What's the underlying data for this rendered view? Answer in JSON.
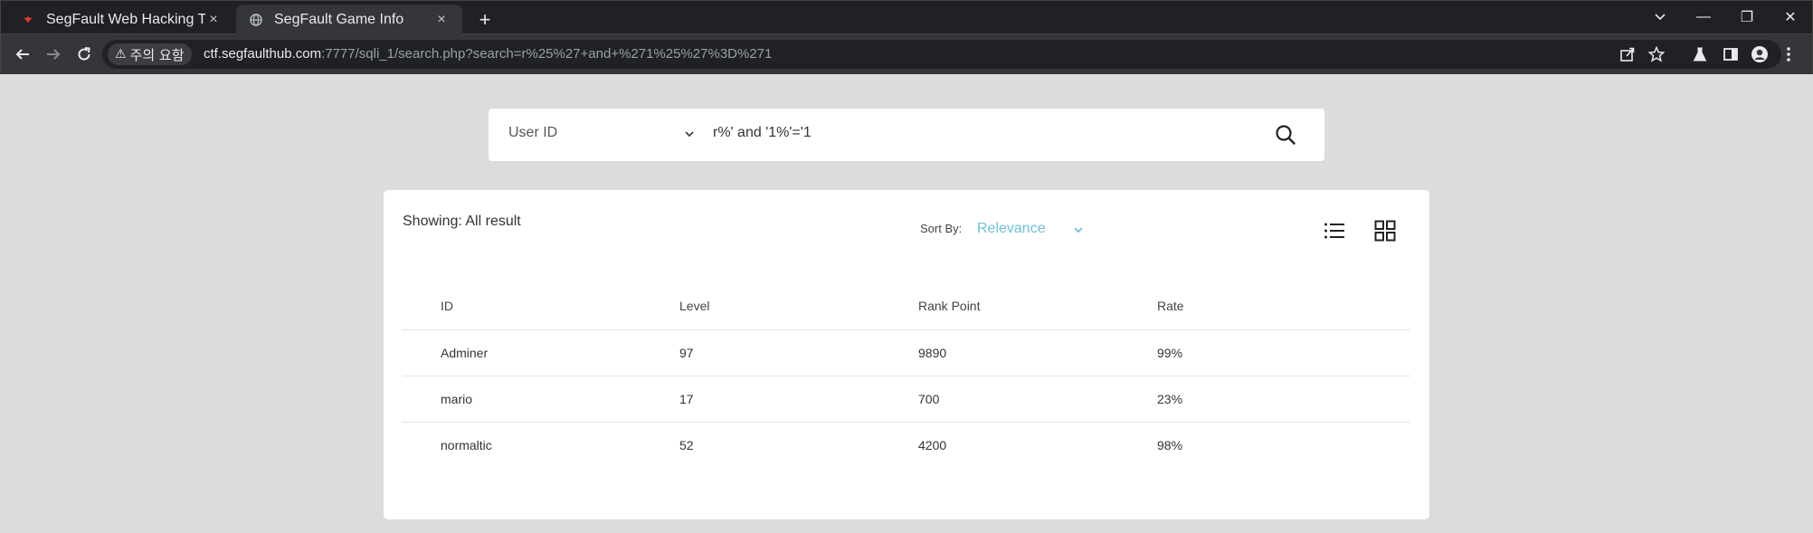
{
  "browser": {
    "tabs": [
      {
        "title": "SegFault Web Hacking Trai",
        "close": "×"
      },
      {
        "title": "SegFault Game Info",
        "close": "×"
      }
    ],
    "new_tab": "+",
    "window_controls": {
      "minimize": "—",
      "restore": "❐",
      "close": "✕"
    },
    "security_label": "주의 요함",
    "url_host": "ctf.segfaulthub.com",
    "url_path": ":7777/sqli_1/search.php?search=r%25%27+and+%271%25%27%3D%271"
  },
  "search": {
    "field_label": "User ID",
    "query": "r%' and '1%'='1"
  },
  "results": {
    "showing": "Showing: All result",
    "sort_label": "Sort By:",
    "sort_value": "Relevance",
    "columns": [
      "ID",
      "Level",
      "Rank Point",
      "Rate"
    ],
    "rows": [
      [
        "Adminer",
        "97",
        "9890",
        "99%"
      ],
      [
        "mario",
        "17",
        "700",
        "23%"
      ],
      [
        "normaltic",
        "52",
        "4200",
        "98%"
      ]
    ]
  },
  "colors": {
    "accent": "#6fc0dc",
    "page_bg": "#dcdcdc",
    "chrome_dark": "#202124"
  },
  "icons": [
    "favicon-segfault-icon",
    "globe-icon",
    "back-icon",
    "forward-icon",
    "reload-icon",
    "warning-icon",
    "share-icon",
    "star-icon",
    "flask-icon",
    "sidebar-icon",
    "profile-icon",
    "menu-icon",
    "chevron-down-icon",
    "search-icon",
    "list-view-icon",
    "grid-view-icon"
  ]
}
